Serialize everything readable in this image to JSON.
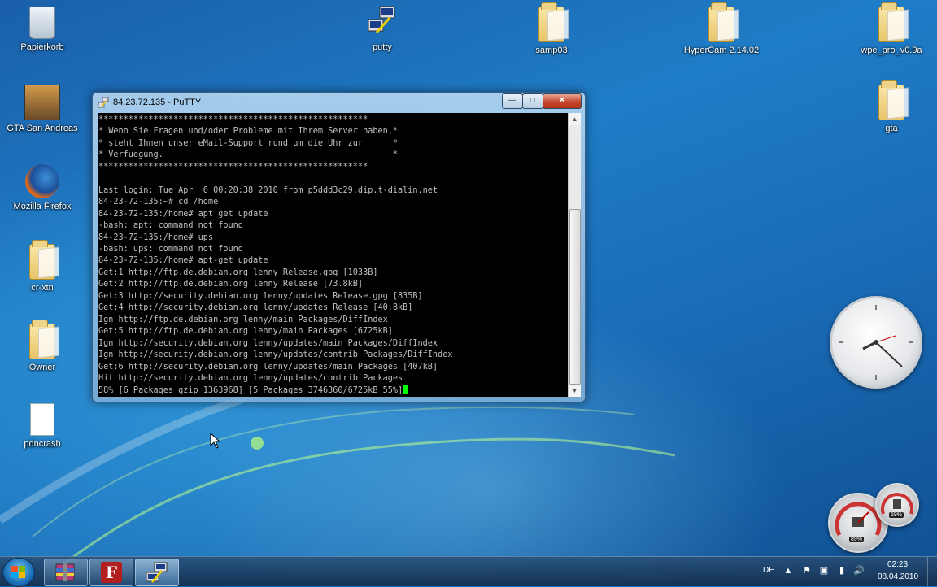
{
  "desktop": {
    "icons": [
      {
        "label": "Papierkorb"
      },
      {
        "label": "GTA San Andreas"
      },
      {
        "label": "Mozilla Firefox"
      },
      {
        "label": "cr-xtn"
      },
      {
        "label": "Owner"
      },
      {
        "label": "pdncrash"
      },
      {
        "label": "putty"
      },
      {
        "label": "samp03"
      },
      {
        "label": "HyperCam 2.14.02"
      },
      {
        "label": "wpe_pro_v0.9a"
      },
      {
        "label": "gta"
      }
    ]
  },
  "putty_window": {
    "title": "84.23.72.135 - PuTTY",
    "lines": [
      "******************************************************",
      "* Wenn Sie Fragen und/oder Probleme mit Ihrem Server haben,*",
      "* steht Ihnen unser eMail-Support rund um die Uhr zur      *",
      "* Verfuegung.                                              *",
      "******************************************************",
      "",
      "Last login: Tue Apr  6 00:20:38 2010 from p5ddd3c29.dip.t-dialin.net",
      "84-23-72-135:~# cd /home",
      "84-23-72-135:/home# apt get update",
      "-bash: apt: command not found",
      "84-23-72-135:/home# ups",
      "-bash: ups: command not found",
      "84-23-72-135:/home# apt-get update",
      "Get:1 http://ftp.de.debian.org lenny Release.gpg [1033B]",
      "Get:2 http://ftp.de.debian.org lenny Release [73.8kB]",
      "Get:3 http://security.debian.org lenny/updates Release.gpg [835B]",
      "Get:4 http://security.debian.org lenny/updates Release [40.8kB]",
      "Ign http://ftp.de.debian.org lenny/main Packages/DiffIndex",
      "Get:5 http://ftp.de.debian.org lenny/main Packages [6725kB]",
      "Ign http://security.debian.org lenny/updates/main Packages/DiffIndex",
      "Ign http://security.debian.org lenny/updates/contrib Packages/DiffIndex",
      "Get:6 http://security.debian.org lenny/updates/main Packages [407kB]",
      "Hit http://security.debian.org lenny/updates/contrib Packages",
      "58% [6 Packages gzip 1363968] [5 Packages 3746360/6725kB 55%]"
    ]
  },
  "gadgets": {
    "meter_left": "89%",
    "meter_right": "59%"
  },
  "taskbar": {
    "buttons": [
      {
        "name": "winrar-button",
        "icon": "archive-icon"
      },
      {
        "name": "filezilla-button",
        "icon": "filezilla-icon"
      },
      {
        "name": "putty-button",
        "icon": "putty-icon"
      }
    ],
    "language": "DE",
    "time": "02:23",
    "date": "08.04.2010"
  },
  "colors": {
    "terminal_bg": "#000000",
    "terminal_text": "#c0c0c0",
    "cursor": "#00ff00"
  }
}
